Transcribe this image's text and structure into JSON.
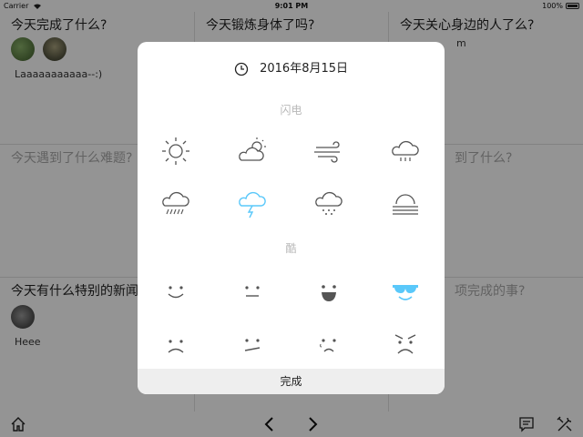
{
  "status_bar": {
    "carrier": "Carrier",
    "time": "9:01 PM",
    "battery": "100%"
  },
  "cards": [
    {
      "question": "今天完成了什么?",
      "note": "Laaaaaaaaaaa--:)"
    },
    {
      "question": "今天锻炼身体了吗?",
      "note": ""
    },
    {
      "question": "今天关心身边的人了么?",
      "note": "m"
    },
    {
      "question": "今天遇到了什么难题?",
      "note": ""
    },
    {
      "question": "",
      "note": ""
    },
    {
      "question": "到了什么?",
      "note": ""
    },
    {
      "question": "今天有什么特别的新闻",
      "note": "Heee"
    },
    {
      "question": "",
      "note": ""
    },
    {
      "question": "项完成的事?",
      "note": ""
    }
  ],
  "modal": {
    "date": "2016年8月15日",
    "weather_title": "闪电",
    "mood_title": "酷",
    "done_label": "完成",
    "weather_icons": [
      "sunny-icon",
      "partly-cloudy-icon",
      "windy-icon",
      "rain-cloud-icon",
      "heavy-rain-icon",
      "thunder-icon",
      "snow-cloud-icon",
      "fog-icon"
    ],
    "mood_icons": [
      "smile-icon",
      "neutral-icon",
      "grin-icon",
      "cool-icon",
      "sad-icon",
      "meh-icon",
      "upset-icon",
      "angry-icon"
    ],
    "selected_weather": "thunder-icon",
    "selected_mood": "cool-icon",
    "accent_color": "#5ac8fa"
  }
}
